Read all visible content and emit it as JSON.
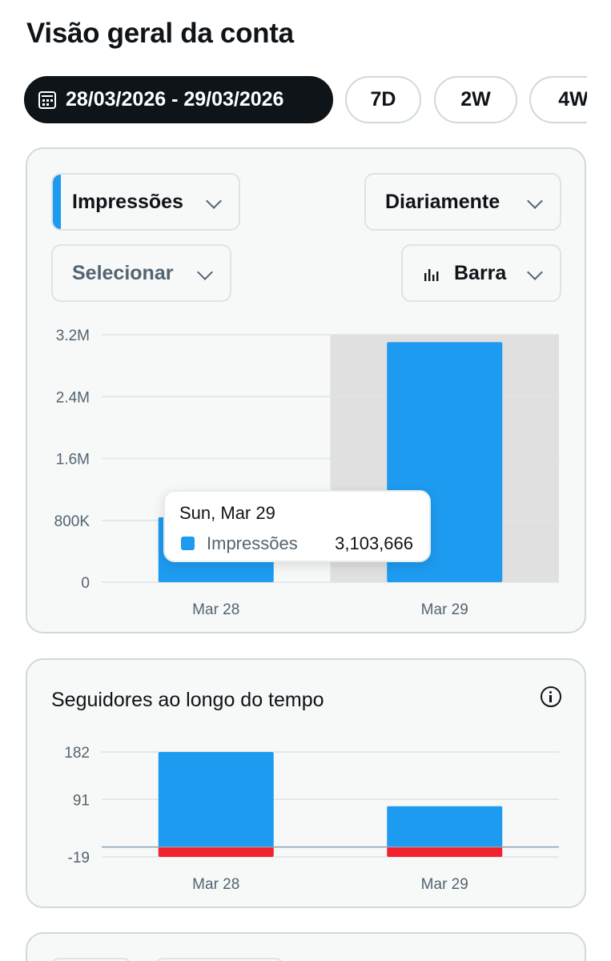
{
  "page": {
    "title": "Visão geral da conta"
  },
  "date_range": {
    "active_label": "28/03/2026 - 29/03/2026",
    "presets": [
      "7D",
      "2W",
      "4W"
    ]
  },
  "controls": {
    "metric": "Impressões",
    "frequency": "Diariamente",
    "compare": "Selecionar",
    "chart_type": "Barra"
  },
  "tooltip": {
    "date": "Sun, Mar 29",
    "label": "Impressões",
    "value": "3,103,666"
  },
  "followers": {
    "title": "Seguidores ao longo do tempo"
  },
  "colors": {
    "accent": "#1d9bf0",
    "negative": "#f4212e",
    "highlight_band": "#e0e0e0"
  },
  "chart_data": [
    {
      "type": "bar",
      "categories": [
        "Mar 28",
        "Mar 29"
      ],
      "series": [
        {
          "name": "Impressões",
          "values": [
            840000,
            3103666
          ]
        }
      ],
      "ylim": [
        0,
        3200000
      ],
      "y_ticks": [
        "0",
        "800K",
        "1.6M",
        "2.4M",
        "3.2M"
      ],
      "highlighted_category": "Mar 29",
      "grid": true
    },
    {
      "type": "bar",
      "title": "Seguidores ao longo do tempo",
      "categories": [
        "Mar 28",
        "Mar 29"
      ],
      "series": [
        {
          "values": [
            182,
            78
          ]
        },
        {
          "values": [
            -19,
            -19
          ]
        }
      ],
      "ylim": [
        -19,
        182
      ],
      "y_ticks": [
        "-19",
        "91",
        "182"
      ],
      "grid": true
    }
  ]
}
